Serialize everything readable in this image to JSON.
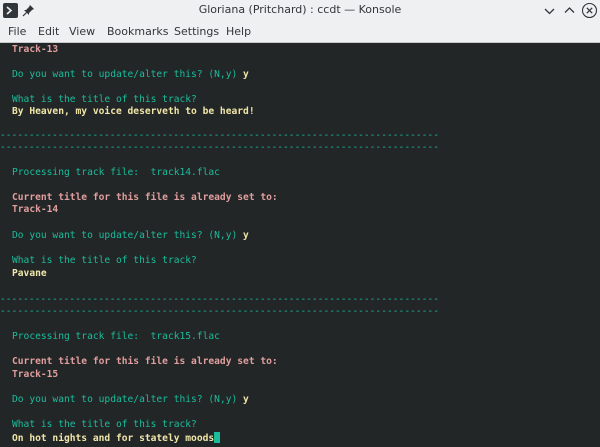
{
  "window": {
    "title": "Gloriana (Pritchard) : ccdt — Konsole"
  },
  "menu": {
    "items": [
      "File",
      "Edit",
      "View",
      "Bookmarks",
      "Settings",
      "Help"
    ]
  },
  "terminal": {
    "divider": "----------------------------------------------------------------------------",
    "top_title": "Track-13",
    "q1_update": "Do you want to update/alter this? (N,y)",
    "q1_answer": "y",
    "q1_title_prompt": "What is the title of this track?",
    "q1_title_value": "By Heaven, my voice deserveth to be heard!",
    "b2_processing": "Processing track file:  track14.flac",
    "b2_current": "Current title for this file is already set to:",
    "b2_current_value": "Track-14",
    "b2_update": "Do you want to update/alter this? (N,y)",
    "b2_answer": "y",
    "b2_title_prompt": "What is the title of this track?",
    "b2_title_value": "Pavane",
    "b3_processing": "Processing track file:  track15.flac",
    "b3_current": "Current title for this file is already set to:",
    "b3_current_value": "Track-15",
    "b3_update": "Do you want to update/alter this? (N,y)",
    "b3_answer": "y",
    "b3_title_prompt": "What is the title of this track?",
    "b3_title_value": "On hot nights and for stately moods"
  },
  "colors": {
    "terminal_bg": "#232627",
    "prompt_cyan": "#1abc9c",
    "label_rose": "#e09e9e",
    "value_yellow": "#f0e6a8",
    "chrome_bg": "#eff0f1"
  },
  "icons": {
    "app": "konsole-icon",
    "pin": "pin-icon",
    "minimize": "minimize-icon",
    "maximize": "maximize-icon",
    "close": "close-icon"
  }
}
